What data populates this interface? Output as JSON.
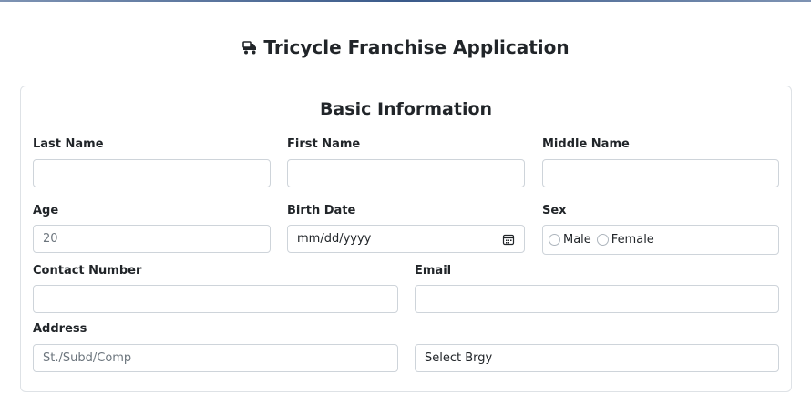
{
  "header": {
    "title": "Tricycle Franchise Application",
    "icon": "tricycle-icon"
  },
  "section": {
    "title": "Basic Information"
  },
  "form": {
    "last_name": {
      "label": "Last Name",
      "value": ""
    },
    "first_name": {
      "label": "First Name",
      "value": ""
    },
    "middle_name": {
      "label": "Middle Name",
      "value": ""
    },
    "age": {
      "label": "Age",
      "placeholder": "20"
    },
    "birth_date": {
      "label": "Birth Date",
      "placeholder": "mm/dd/yyyy",
      "icon": "calendar-icon"
    },
    "sex": {
      "label": "Sex",
      "options": [
        "Male",
        "Female"
      ]
    },
    "contact_number": {
      "label": "Contact Number",
      "value": ""
    },
    "email": {
      "label": "Email",
      "value": ""
    },
    "address": {
      "label": "Address",
      "street_placeholder": "St./Subd/Comp",
      "brgy_selected": "Select Brgy"
    }
  },
  "colors": {
    "border": "#ced4da",
    "card_border": "#dee2e6",
    "text": "#212529",
    "placeholder": "#6c757d",
    "top_strip": "#3a5a8a"
  }
}
